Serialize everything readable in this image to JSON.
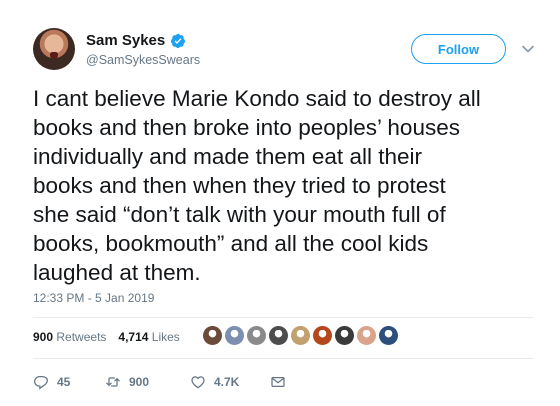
{
  "author": {
    "display_name": "Sam Sykes",
    "handle": "@SamSykesSwears"
  },
  "follow_label": "Follow",
  "tweet": {
    "text": "I cant believe Marie Kondo said to destroy all\nbooks and then broke into peoples’ houses\nindividually and made them eat all their\nbooks and then when they tried to protest\nshe said “don’t talk with your mouth full of\nbooks, bookmouth” and all the cool kids\nlaughed at them.",
    "timestamp": "12:33 PM - 5 Jan 2019"
  },
  "stats": {
    "retweets_count": "900",
    "retweets_label": "Retweets",
    "likes_count": "4,714",
    "likes_label": "Likes"
  },
  "liker_avatar_colors": [
    "#6b4a3a",
    "#7c8fb0",
    "#8a8a8a",
    "#4d4d4d",
    "#c2a070",
    "#b5471c",
    "#3a3a3a",
    "#d9a48b",
    "#2c4f7c"
  ],
  "actions": {
    "reply_count": "45",
    "retweet_count": "900",
    "like_count": "4.7K"
  },
  "colors": {
    "accent": "#1da1f2",
    "secondary_text": "#657786",
    "primary_text": "#14171a"
  }
}
